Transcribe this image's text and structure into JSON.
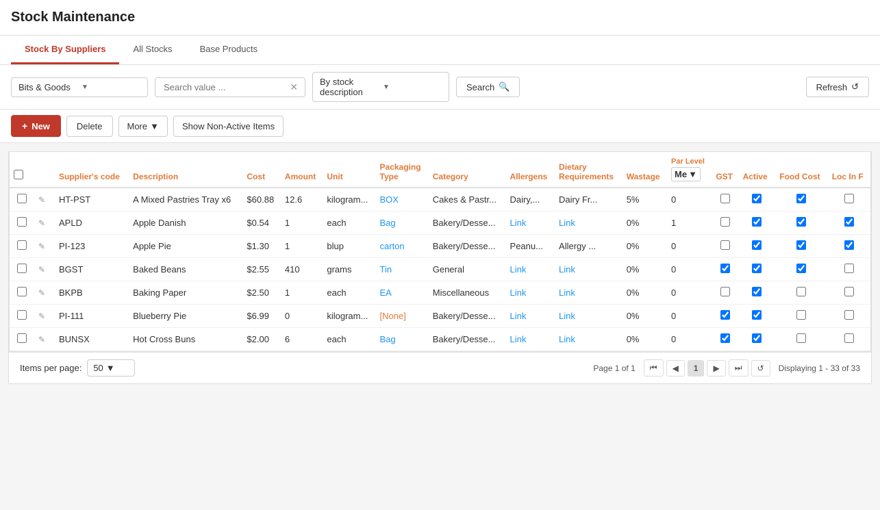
{
  "page": {
    "title": "Stock Maintenance"
  },
  "tabs": [
    {
      "id": "stock-by-suppliers",
      "label": "Stock By Suppliers",
      "active": true
    },
    {
      "id": "all-stocks",
      "label": "All Stocks",
      "active": false
    },
    {
      "id": "base-products",
      "label": "Base Products",
      "active": false
    }
  ],
  "toolbar": {
    "supplier_value": "Bits & Goods",
    "search_placeholder": "Search value ...",
    "filter_value": "By stock description",
    "search_label": "Search",
    "refresh_label": "Refresh"
  },
  "actions": {
    "new_label": "New",
    "delete_label": "Delete",
    "more_label": "More",
    "show_non_active_label": "Show Non-Active Items"
  },
  "table": {
    "par_level_label": "Par Level",
    "par_level_dropdown": "Me",
    "columns": [
      {
        "id": "suppliers_code",
        "label": "Supplier's code"
      },
      {
        "id": "description",
        "label": "Description"
      },
      {
        "id": "cost",
        "label": "Cost"
      },
      {
        "id": "amount",
        "label": "Amount"
      },
      {
        "id": "unit",
        "label": "Unit"
      },
      {
        "id": "packaging_type",
        "label": "Packaging Type"
      },
      {
        "id": "category",
        "label": "Category"
      },
      {
        "id": "allergens",
        "label": "Allergens"
      },
      {
        "id": "dietary_requirements",
        "label": "Dietary Requirements"
      },
      {
        "id": "wastage",
        "label": "Wastage"
      },
      {
        "id": "gst",
        "label": "GST"
      },
      {
        "id": "active",
        "label": "Active"
      },
      {
        "id": "food_cost",
        "label": "Food Cost"
      },
      {
        "id": "loc_in_f",
        "label": "Loc In F"
      }
    ],
    "rows": [
      {
        "suppliers_code": "HT-PST",
        "description": "A Mixed Pastries Tray x6",
        "cost": "$60.88",
        "amount": "12.6",
        "unit": "kilogram...",
        "packaging_type": "BOX",
        "category": "Cakes & Pastr...",
        "allergens": "Dairy,...",
        "dietary_requirements": "Dairy Fr...",
        "wastage": "5%",
        "par_level": "0",
        "gst_checked": false,
        "active_checked": true,
        "food_cost_checked": true,
        "loc_checked": false
      },
      {
        "suppliers_code": "APLD",
        "description": "Apple Danish",
        "cost": "$0.54",
        "amount": "1",
        "unit": "each",
        "packaging_type": "Bag",
        "category": "Bakery/Desse...",
        "allergens": "Link",
        "dietary_requirements": "Link",
        "wastage": "0%",
        "par_level": "1",
        "gst_checked": false,
        "active_checked": true,
        "food_cost_checked": true,
        "loc_checked": true
      },
      {
        "suppliers_code": "PI-123",
        "description": "Apple Pie",
        "cost": "$1.30",
        "amount": "1",
        "unit": "blup",
        "packaging_type": "carton",
        "category": "Bakery/Desse...",
        "allergens": "Peanu...",
        "dietary_requirements": "Allergy ...",
        "wastage": "0%",
        "par_level": "0",
        "gst_checked": false,
        "active_checked": true,
        "food_cost_checked": true,
        "loc_checked": true
      },
      {
        "suppliers_code": "BGST",
        "description": "Baked Beans",
        "cost": "$2.55",
        "amount": "410",
        "unit": "grams",
        "packaging_type": "Tin",
        "category": "General",
        "allergens": "Link",
        "dietary_requirements": "Link",
        "wastage": "0%",
        "par_level": "0",
        "gst_checked": true,
        "active_checked": true,
        "food_cost_checked": true,
        "loc_checked": false
      },
      {
        "suppliers_code": "BKPB",
        "description": "Baking Paper",
        "cost": "$2.50",
        "amount": "1",
        "unit": "each",
        "packaging_type": "EA",
        "category": "Miscellaneous",
        "allergens": "Link",
        "dietary_requirements": "Link",
        "wastage": "0%",
        "par_level": "0",
        "gst_checked": false,
        "active_checked": true,
        "food_cost_checked": false,
        "loc_checked": false
      },
      {
        "suppliers_code": "PI-111",
        "description": "Blueberry Pie",
        "cost": "$6.99",
        "amount": "0",
        "unit": "kilogram...",
        "packaging_type": "[None]",
        "category": "Bakery/Desse...",
        "allergens": "Link",
        "dietary_requirements": "Link",
        "wastage": "0%",
        "par_level": "0",
        "gst_checked": true,
        "active_checked": true,
        "food_cost_checked": false,
        "loc_checked": false
      },
      {
        "suppliers_code": "BUNSX",
        "description": "Hot Cross Buns",
        "cost": "$2.00",
        "amount": "6",
        "unit": "each",
        "packaging_type": "Bag",
        "category": "Bakery/Desse...",
        "allergens": "Link",
        "dietary_requirements": "Link",
        "wastage": "0%",
        "par_level": "0",
        "gst_checked": true,
        "active_checked": true,
        "food_cost_checked": false,
        "loc_checked": false
      }
    ]
  },
  "pagination": {
    "items_per_page_label": "Items per page:",
    "items_per_page_value": "50",
    "page_label": "Page 1 of 1",
    "current_page": "1",
    "displaying": "Displaying 1 - 33 of 33"
  }
}
